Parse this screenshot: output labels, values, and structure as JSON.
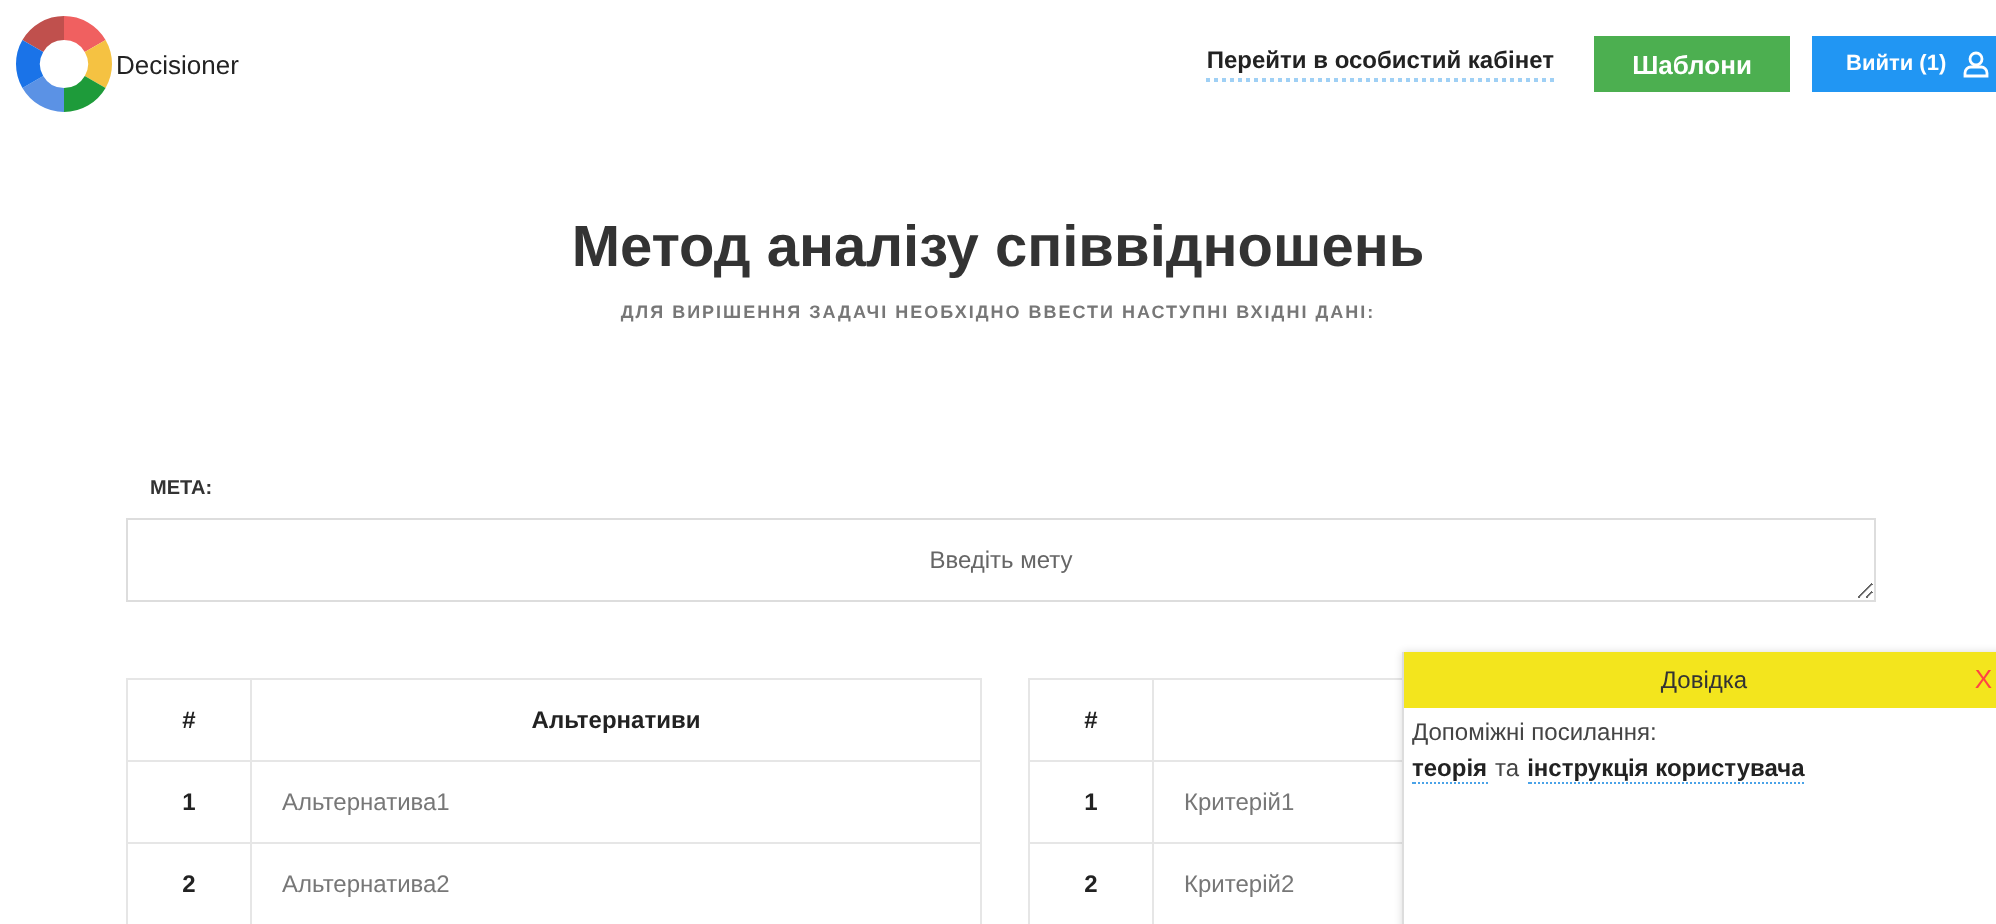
{
  "header": {
    "logo_text": "Decisioner",
    "cabinet_link": "Перейти в особистий кабінет",
    "templates_button": "Шаблони",
    "logout_button": "Вийти (1)"
  },
  "title": "Метод аналізу співвідношень",
  "subtitle": "ДЛЯ ВИРІШЕННЯ ЗАДАЧІ НЕОБХІДНО ВВЕСТИ НАСТУПНІ ВХІДНІ ДАНІ:",
  "goal": {
    "label": "МЕТА:",
    "placeholder": "Введіть мету"
  },
  "tables": [
    {
      "columns": [
        "#",
        "Альтернативи"
      ],
      "rows": [
        [
          "1",
          "Альтернатива1"
        ],
        [
          "2",
          "Альтернатива2"
        ]
      ]
    },
    {
      "columns": [
        "#"
      ],
      "rows": [
        [
          "1",
          "Критерій1"
        ],
        [
          "2",
          "Критерій2"
        ]
      ]
    }
  ],
  "help": {
    "title": "Довідка",
    "close": "X",
    "intro": "Допоміжні посилання:",
    "links": [
      "теорія",
      "інструкція користувача"
    ],
    "joiner": "та"
  }
}
